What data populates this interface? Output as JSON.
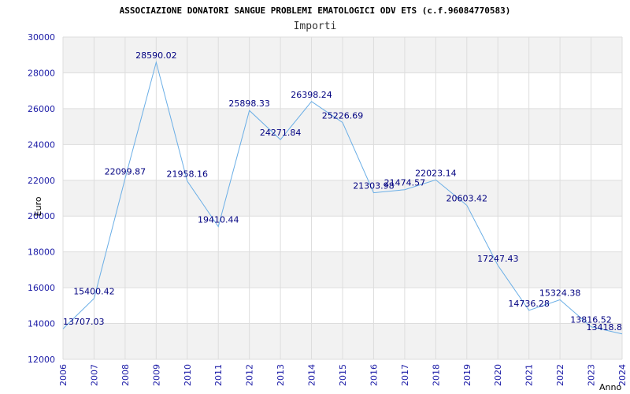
{
  "chart_data": {
    "type": "line",
    "title": "ASSOCIAZIONE DONATORI SANGUE PROBLEMI EMATOLOGICI ODV ETS (c.f.96084770583)",
    "subtitle": "Importi",
    "xlabel": "Anno",
    "ylabel": "Euro",
    "x": [
      "2006",
      "2007",
      "2008",
      "2009",
      "2010",
      "2011",
      "2012",
      "2013",
      "2014",
      "2015",
      "2016",
      "2017",
      "2018",
      "2019",
      "2020",
      "2021",
      "2022",
      "2023",
      "2024"
    ],
    "values": [
      13707.03,
      15400.42,
      22099.87,
      28590.02,
      21958.16,
      19410.44,
      25898.33,
      24271.84,
      26398.24,
      25226.69,
      21303.98,
      21474.57,
      22023.14,
      20603.42,
      17247.43,
      14736.28,
      15324.38,
      13816.52,
      13418.8
    ],
    "data_labels": [
      "13707.03",
      "15400.42",
      "22099.87",
      "28590.02",
      "21958.16",
      "19410.44",
      "25898.33",
      "24271.84",
      "26398.24",
      "25226.69",
      "21303.98",
      "21474.57",
      "22023.14",
      "20603.42",
      "17247.43",
      "14736.28",
      "15324.38",
      "13816.52",
      "13418.8"
    ],
    "yticks": [
      12000,
      14000,
      16000,
      18000,
      20000,
      22000,
      24000,
      26000,
      28000,
      30000
    ],
    "ylim": [
      12000,
      30000
    ],
    "grid": true,
    "colors": {
      "line": "#6aaee6",
      "band": "#f2f2f2",
      "grid": "#dddddd",
      "tick": "#1a1aa6",
      "label": "#000080"
    }
  }
}
